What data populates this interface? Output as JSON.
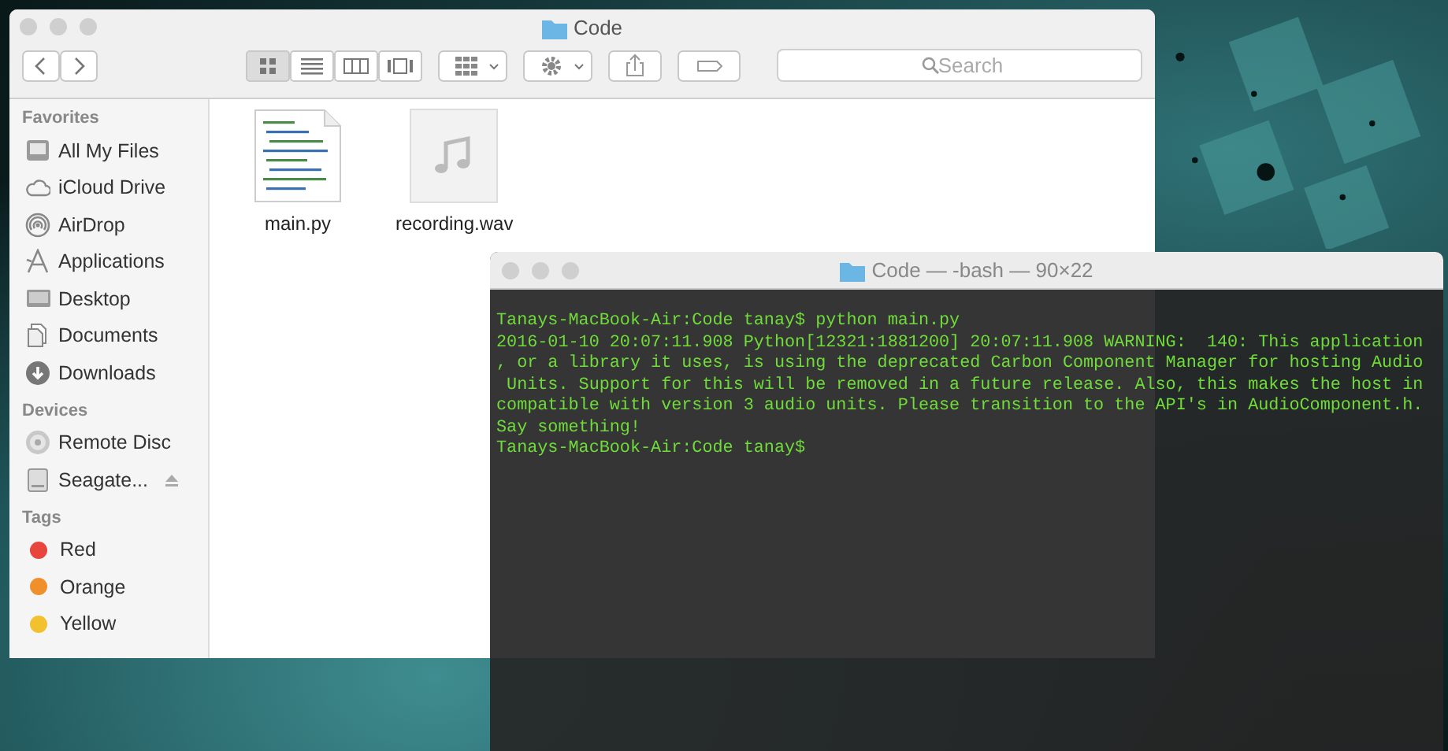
{
  "finder": {
    "title": "Code",
    "view_modes": [
      {
        "kind": "icon",
        "selected": true
      },
      {
        "kind": "list",
        "selected": false
      },
      {
        "kind": "column",
        "selected": false
      },
      {
        "kind": "gallery",
        "selected": false
      }
    ],
    "search": {
      "placeholder": "Search"
    },
    "sidebar": [
      {
        "heading": "Favorites",
        "items": [
          {
            "label": "All My Files",
            "kind": "files"
          },
          {
            "label": "iCloud Drive",
            "kind": "cloud"
          },
          {
            "label": "AirDrop",
            "kind": "airdrop"
          },
          {
            "label": "Applications",
            "kind": "apps"
          },
          {
            "label": "Desktop",
            "kind": "desktop"
          },
          {
            "label": "Documents",
            "kind": "documents"
          },
          {
            "label": "Downloads",
            "kind": "downloads"
          }
        ]
      },
      {
        "heading": "Devices",
        "items": [
          {
            "label": "Remote Disc",
            "kind": "disc"
          },
          {
            "label": "Seagate...",
            "kind": "drive",
            "eject": true
          }
        ]
      },
      {
        "heading": "Tags",
        "items": [
          {
            "label": "Red",
            "kind": "tag",
            "color": "#e8453c"
          },
          {
            "label": "Orange",
            "kind": "tag",
            "color": "#f0902c"
          },
          {
            "label": "Yellow",
            "kind": "tag",
            "color": "#f2c12e"
          }
        ]
      }
    ],
    "files": [
      {
        "name": "main.py",
        "kind": "code"
      },
      {
        "name": "recording.wav",
        "kind": "audio"
      }
    ]
  },
  "terminal": {
    "title": "Code — -bash — 90×22",
    "lines": [
      "Tanays-MacBook-Air:Code tanay$ python main.py",
      "2016-01-10 20:07:11.908 Python[12321:1881200] 20:07:11.908 WARNING:  140: This application",
      ", or a library it uses, is using the deprecated Carbon Component Manager for hosting Audio",
      " Units. Support for this will be removed in a future release. Also, this makes the host in",
      "compatible with version 3 audio units. Please transition to the API's in AudioComponent.h.",
      "Say something!",
      "Tanays-MacBook-Air:Code tanay$"
    ]
  }
}
